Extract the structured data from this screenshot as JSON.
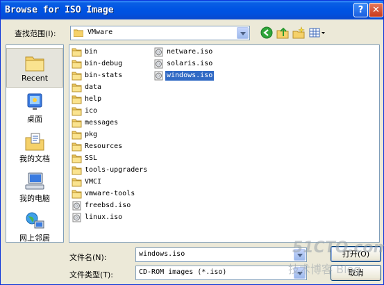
{
  "window": {
    "title": "Browse for ISO Image"
  },
  "titlebar_buttons": {
    "help": "?",
    "close": "✕"
  },
  "look_in": {
    "label": "查找范围(I):",
    "value": "VMware"
  },
  "toolbar": {
    "icons": [
      "back-icon",
      "up-folder-icon",
      "new-folder-icon",
      "view-menu-icon"
    ]
  },
  "places": [
    {
      "label": "Recent",
      "icon": "recent-folder-icon"
    },
    {
      "label": "桌面",
      "icon": "desktop-icon"
    },
    {
      "label": "我的文档",
      "icon": "my-documents-icon"
    },
    {
      "label": "我的电脑",
      "icon": "my-computer-icon"
    },
    {
      "label": "网上邻居",
      "icon": "network-places-icon"
    }
  ],
  "files": {
    "column1": [
      {
        "name": "bin",
        "type": "folder"
      },
      {
        "name": "bin-debug",
        "type": "folder"
      },
      {
        "name": "bin-stats",
        "type": "folder"
      },
      {
        "name": "data",
        "type": "folder"
      },
      {
        "name": "help",
        "type": "folder"
      },
      {
        "name": "ico",
        "type": "folder"
      },
      {
        "name": "messages",
        "type": "folder"
      },
      {
        "name": "pkg",
        "type": "folder"
      },
      {
        "name": "Resources",
        "type": "folder"
      },
      {
        "name": "SSL",
        "type": "folder"
      },
      {
        "name": "tools-upgraders",
        "type": "folder"
      },
      {
        "name": "VMCI",
        "type": "folder"
      },
      {
        "name": "vmware-tools",
        "type": "folder"
      },
      {
        "name": "freebsd.iso",
        "type": "iso"
      },
      {
        "name": "linux.iso",
        "type": "iso"
      }
    ],
    "column2": [
      {
        "name": "netware.iso",
        "type": "iso"
      },
      {
        "name": "solaris.iso",
        "type": "iso"
      },
      {
        "name": "windows.iso",
        "type": "iso",
        "selected": true
      }
    ]
  },
  "filename": {
    "label": "文件名(N):",
    "value": "windows.iso"
  },
  "filetype": {
    "label": "文件类型(T):",
    "value": "CD-ROM images (*.iso)"
  },
  "buttons": {
    "open": "打开(O)",
    "cancel": "取消"
  },
  "watermark": {
    "line1": "51CTO.com",
    "line2": "技术博客 Blog"
  },
  "colors": {
    "titlebar": "#0054e3",
    "selection": "#316ac5",
    "face": "#ece9d8",
    "folder": "#f5d16a"
  }
}
